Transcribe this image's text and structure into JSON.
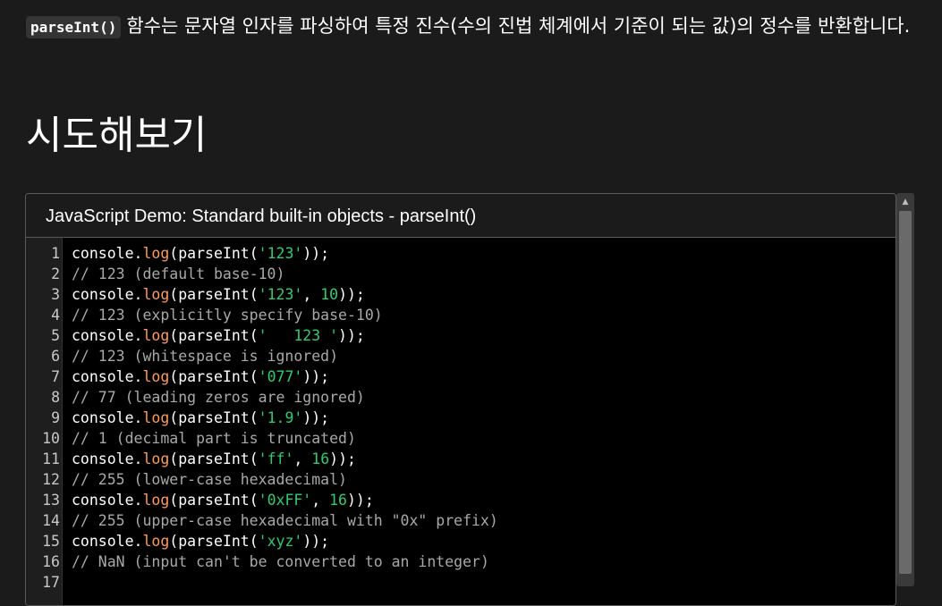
{
  "intro": {
    "code": "parseInt()",
    "text": "함수는 문자열 인자를 파싱하여 특정 진수(수의 진법 체계에서 기준이 되는 값)의 정수를 반환합니다."
  },
  "section_heading": "시도해보기",
  "demo": {
    "title": "JavaScript Demo: Standard built-in objects - parseInt()",
    "lines": [
      {
        "n": "1",
        "parts": [
          {
            "t": "console.",
            "c": "plain"
          },
          {
            "t": "log",
            "c": "fn"
          },
          {
            "t": "(parseInt(",
            "c": "plain"
          },
          {
            "t": "'123'",
            "c": "str"
          },
          {
            "t": "));",
            "c": "plain"
          }
        ]
      },
      {
        "n": "2",
        "parts": [
          {
            "t": "// 123 (default base-10)",
            "c": "cmt"
          }
        ]
      },
      {
        "n": "3",
        "parts": [
          {
            "t": "console.",
            "c": "plain"
          },
          {
            "t": "log",
            "c": "fn"
          },
          {
            "t": "(parseInt(",
            "c": "plain"
          },
          {
            "t": "'123'",
            "c": "str"
          },
          {
            "t": ", ",
            "c": "plain"
          },
          {
            "t": "10",
            "c": "num"
          },
          {
            "t": "));",
            "c": "plain"
          }
        ]
      },
      {
        "n": "4",
        "parts": [
          {
            "t": "// 123 (explicitly specify base-10)",
            "c": "cmt"
          }
        ]
      },
      {
        "n": "5",
        "parts": [
          {
            "t": "console.",
            "c": "plain"
          },
          {
            "t": "log",
            "c": "fn"
          },
          {
            "t": "(parseInt(",
            "c": "plain"
          },
          {
            "t": "'   123 '",
            "c": "str"
          },
          {
            "t": "));",
            "c": "plain"
          }
        ]
      },
      {
        "n": "6",
        "parts": [
          {
            "t": "// 123 (whitespace is ignored)",
            "c": "cmt"
          }
        ]
      },
      {
        "n": "7",
        "parts": [
          {
            "t": "console.",
            "c": "plain"
          },
          {
            "t": "log",
            "c": "fn"
          },
          {
            "t": "(parseInt(",
            "c": "plain"
          },
          {
            "t": "'077'",
            "c": "str"
          },
          {
            "t": "));",
            "c": "plain"
          }
        ]
      },
      {
        "n": "8",
        "parts": [
          {
            "t": "// 77 (leading zeros are ignored)",
            "c": "cmt"
          }
        ]
      },
      {
        "n": "9",
        "parts": [
          {
            "t": "console.",
            "c": "plain"
          },
          {
            "t": "log",
            "c": "fn"
          },
          {
            "t": "(parseInt(",
            "c": "plain"
          },
          {
            "t": "'1.9'",
            "c": "str"
          },
          {
            "t": "));",
            "c": "plain"
          }
        ]
      },
      {
        "n": "10",
        "parts": [
          {
            "t": "// 1 (decimal part is truncated)",
            "c": "cmt"
          }
        ]
      },
      {
        "n": "11",
        "parts": [
          {
            "t": "console.",
            "c": "plain"
          },
          {
            "t": "log",
            "c": "fn"
          },
          {
            "t": "(parseInt(",
            "c": "plain"
          },
          {
            "t": "'ff'",
            "c": "str"
          },
          {
            "t": ", ",
            "c": "plain"
          },
          {
            "t": "16",
            "c": "num"
          },
          {
            "t": "));",
            "c": "plain"
          }
        ]
      },
      {
        "n": "12",
        "parts": [
          {
            "t": "// 255 (lower-case hexadecimal)",
            "c": "cmt"
          }
        ]
      },
      {
        "n": "13",
        "parts": [
          {
            "t": "console.",
            "c": "plain"
          },
          {
            "t": "log",
            "c": "fn"
          },
          {
            "t": "(parseInt(",
            "c": "plain"
          },
          {
            "t": "'0xFF'",
            "c": "str"
          },
          {
            "t": ", ",
            "c": "plain"
          },
          {
            "t": "16",
            "c": "num"
          },
          {
            "t": "));",
            "c": "plain"
          }
        ]
      },
      {
        "n": "14",
        "parts": [
          {
            "t": "// 255 (upper-case hexadecimal with \"0x\" prefix)",
            "c": "cmt"
          }
        ]
      },
      {
        "n": "15",
        "parts": [
          {
            "t": "console.",
            "c": "plain"
          },
          {
            "t": "log",
            "c": "fn"
          },
          {
            "t": "(parseInt(",
            "c": "plain"
          },
          {
            "t": "'xyz'",
            "c": "str"
          },
          {
            "t": "));",
            "c": "plain"
          }
        ]
      },
      {
        "n": "16",
        "parts": [
          {
            "t": "// NaN (input can't be converted to an integer)",
            "c": "cmt"
          }
        ]
      },
      {
        "n": "17",
        "parts": []
      }
    ]
  },
  "scrollbar": {
    "up_icon": "triangle-up-icon"
  },
  "colors": {
    "background": "#1b1b1b",
    "editor_background": "#000000",
    "function": "#ff9a5c",
    "string": "#2ecc71",
    "comment": "#a8a8a8"
  }
}
